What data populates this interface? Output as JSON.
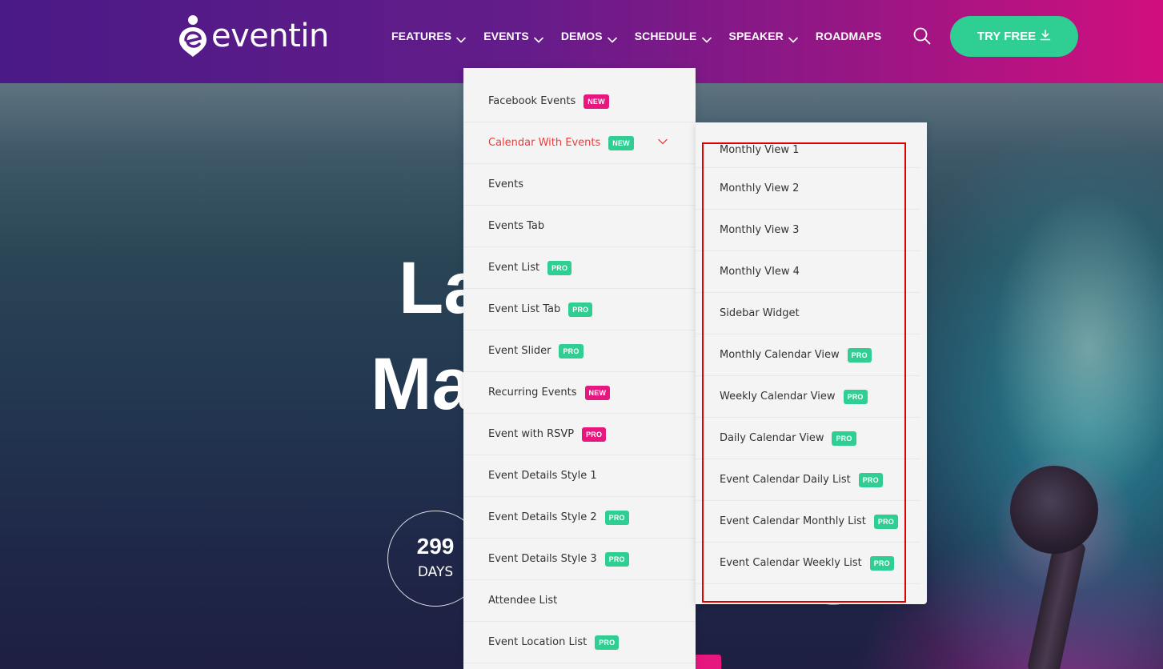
{
  "brand": {
    "name": "eventin"
  },
  "nav": {
    "items": [
      {
        "label": "FEATURES",
        "has_dropdown": true
      },
      {
        "label": "EVENTS",
        "has_dropdown": true
      },
      {
        "label": "DEMOS",
        "has_dropdown": true
      },
      {
        "label": "SCHEDULE",
        "has_dropdown": true
      },
      {
        "label": "SPEAKER",
        "has_dropdown": true
      },
      {
        "label": "ROADMAPS",
        "has_dropdown": false
      }
    ],
    "search_icon": "search-icon",
    "cta_label": "TRY FREE",
    "cta_icon": "download-icon"
  },
  "hero": {
    "title_line1": "La",
    "title_line2": "Ma",
    "countdown": {
      "value": "299",
      "label": "DAYS"
    }
  },
  "events_menu": {
    "items": [
      {
        "label": "Facebook Events",
        "badge": "NEW",
        "badge_type": "new"
      },
      {
        "label": "Calendar With Events",
        "badge": "NEW",
        "badge_type": "pro",
        "active": true,
        "has_submenu": true
      },
      {
        "label": "Events",
        "badge": "",
        "badge_type": ""
      },
      {
        "label": "Events Tab",
        "badge": "",
        "badge_type": ""
      },
      {
        "label": "Event List",
        "badge": "PRO",
        "badge_type": "pro"
      },
      {
        "label": "Event List Tab",
        "badge": "PRO",
        "badge_type": "pro"
      },
      {
        "label": "Event Slider",
        "badge": "PRO",
        "badge_type": "pro"
      },
      {
        "label": "Recurring Events",
        "badge": "NEW",
        "badge_type": "new"
      },
      {
        "label": "Event with RSVP",
        "badge": "PRO",
        "badge_type": "pro-pink"
      },
      {
        "label": "Event Details Style 1",
        "badge": "",
        "badge_type": ""
      },
      {
        "label": "Event Details Style 2",
        "badge": "PRO",
        "badge_type": "pro"
      },
      {
        "label": "Event Details Style 3",
        "badge": "PRO",
        "badge_type": "pro"
      },
      {
        "label": "Attendee List",
        "badge": "",
        "badge_type": ""
      },
      {
        "label": "Event Location List",
        "badge": "PRO",
        "badge_type": "pro"
      }
    ]
  },
  "calendar_submenu": {
    "items": [
      {
        "label": "Monthly View 1",
        "badge": ""
      },
      {
        "label": "Monthly View 2",
        "badge": ""
      },
      {
        "label": "Monthly View 3",
        "badge": ""
      },
      {
        "label": "Monthly VIew 4",
        "badge": ""
      },
      {
        "label": "Sidebar Widget",
        "badge": ""
      },
      {
        "label": "Monthly Calendar View",
        "badge": "PRO"
      },
      {
        "label": "Weekly Calendar View",
        "badge": "PRO"
      },
      {
        "label": "Daily Calendar View",
        "badge": "PRO"
      },
      {
        "label": "Event Calendar Daily List",
        "badge": "PRO"
      },
      {
        "label": "Event Calendar Monthly List",
        "badge": "PRO"
      },
      {
        "label": "Event Calendar Weekly List",
        "badge": "PRO"
      }
    ]
  },
  "colors": {
    "header_start": "#4a1a86",
    "header_end": "#d10f7e",
    "cta": "#2fcf93",
    "badge_new": "#e6177f",
    "badge_pro": "#2fcf93",
    "active_item": "#ef3b3b",
    "highlight": "#e00000"
  }
}
